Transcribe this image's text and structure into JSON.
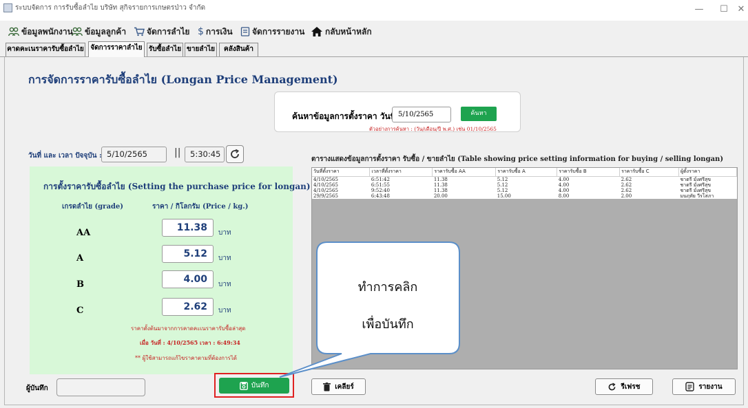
{
  "window": {
    "title": "ระบบจัดการ การรับซื้อลำไย บริษัท สุกิจรายการเกษตรป่าว จำกัด",
    "minimize": "—",
    "maximize": "☐",
    "close": "✕"
  },
  "menu": [
    {
      "label": "ข้อมูลพนักงาน",
      "icon": "people-icon"
    },
    {
      "label": "ข้อมูลลูกค้า",
      "icon": "customers-icon"
    },
    {
      "label": "จัดการลำไย",
      "icon": "cart-icon"
    },
    {
      "label": "การเงิน",
      "icon": "dollar-icon"
    },
    {
      "label": "จัดการรายงาน",
      "icon": "report-icon"
    },
    {
      "label": "กลับหน้าหลัก",
      "icon": "home-icon"
    }
  ],
  "tabs": [
    {
      "label": "คาดคะเนราคารับซื้อลำไย",
      "active": false
    },
    {
      "label": "จัดการราคาลำไย",
      "active": true
    },
    {
      "label": "รับซื้อลำไย",
      "active": false
    },
    {
      "label": "ขายลำไย",
      "active": false
    },
    {
      "label": "คลังสินค้า",
      "active": false
    }
  ],
  "page_title": "การจัดการราคารับซื้อลำไย (Longan Price Management)",
  "search": {
    "label": "ค้นหาข้อมูลการตั้งราคา  วันที่ :",
    "value": "5/10/2565",
    "button": "ค้นหา",
    "hint": "ตัวอย่างการค้นหา : (วัน/เดือน/ปี พ.ศ.) เช่น 01/10/2565"
  },
  "datetime": {
    "label": "วันที่ และ เวลา ปัจจุบัน :",
    "date": "5/10/2565",
    "separator": "||",
    "time": "5:30:45"
  },
  "price_panel": {
    "title": "การตั้งราคารับซื้อลำไย (Setting the purchase price for longan)",
    "grade_header": "เกรดลำไย (grade)",
    "price_header": "ราคา / กิโลกรัม (Price / kg.)",
    "unit": "บาท",
    "grades": [
      {
        "grade": "AA",
        "price": "11.38"
      },
      {
        "grade": "A",
        "price": "5.12"
      },
      {
        "grade": "B",
        "price": "4.00"
      },
      {
        "grade": "C",
        "price": "2.62"
      }
    ],
    "note1": "ราคาตั้งต้นมาจากการคาดคะเนราคารับซื้อล่าสุด",
    "note2": "เมื่อ วันที่ : 4/10/2565   เวลา : 6:49:34",
    "note3": "** ผู้ใช้สามารถแก้ไขราคาตามที่ต้องการได้"
  },
  "table": {
    "caption": "ตารางแสดงข้อมูลการตั้งราคา รับซื้อ / ขายลำไย (Table showing price setting information for buying / selling longan)",
    "columns": [
      "วันที่ตั้งราคา",
      "เวลาที่ตั้งราคา",
      "ราคารับซื้อ AA",
      "ราคารับซื้อ A",
      "ราคารับซื้อ B",
      "ราคารับซื้อ C",
      "ผู้ตั้งราคา"
    ],
    "rows": [
      [
        "4/10/2565",
        "6:51:42",
        "11.38",
        "5.12",
        "4.00",
        "2.62",
        "ชาตรี มั่งศรีสุข"
      ],
      [
        "4/10/2565",
        "6:51:55",
        "11.38",
        "5.12",
        "4.00",
        "2.62",
        "ชาตรี มั่งศรีสุข"
      ],
      [
        "4/10/2565",
        "9:52:40",
        "11.38",
        "5.12",
        "4.00",
        "2.62",
        "ชาตรี มั่งศรีสุข"
      ],
      [
        "29/9/2565",
        "6:43:48",
        "20.00",
        "15.00",
        "8.00",
        "2.00",
        "มนฤทัย วีรโสภา"
      ]
    ]
  },
  "footer": {
    "recorder_label": "ผู้บันทึก",
    "save": "บันทึก",
    "clear": "เคลียร์",
    "refresh": "รีเฟรช",
    "report": "รายงาน"
  },
  "callout": {
    "line1": "ทำการคลิก",
    "line2": "เพื่อบันทึก"
  },
  "colors": {
    "accent_green": "#1ea34f",
    "panel_green": "#d8f8d8",
    "title_navy": "#1f3f7a",
    "highlight_red": "#e02020",
    "callout_border": "#5b8fc9"
  }
}
